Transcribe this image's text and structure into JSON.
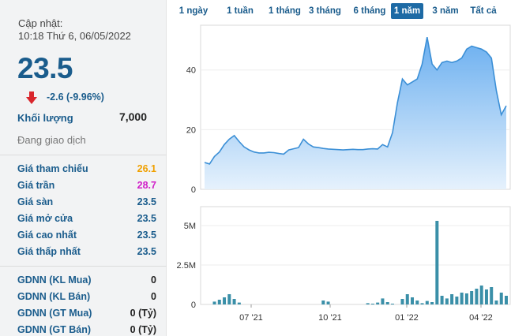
{
  "quote": {
    "updated_label": "Cập nhật:",
    "updated_time": "10:18 Thứ 6, 06/05/2022",
    "price": "23.5",
    "change": "-2.6 (-9.96%)",
    "change_direction_icon": "arrow-down-icon",
    "volume_label": "Khối lượng",
    "volume_value": "7,000",
    "status": "Đang giao dịch"
  },
  "price_rows": [
    {
      "label": "Giá tham chiếu",
      "value": "26.1",
      "color": "#f0a000"
    },
    {
      "label": "Giá trần",
      "value": "28.7",
      "color": "#d020c8"
    },
    {
      "label": "Giá sàn",
      "value": "23.5",
      "color": "#1a5c8c"
    },
    {
      "label": "Giá mở cửa",
      "value": "23.5",
      "color": "#1a5c8c"
    },
    {
      "label": "Giá cao nhất",
      "value": "23.5",
      "color": "#1a5c8c"
    },
    {
      "label": "Giá thấp nhất",
      "value": "23.5",
      "color": "#1a5c8c"
    }
  ],
  "foreign_rows": [
    {
      "label": "GDNN (KL Mua)",
      "value": "0"
    },
    {
      "label": "GDNN (KL Bán)",
      "value": "0"
    },
    {
      "label": "GDNN (GT Mua)",
      "value": "0 (Tỷ)"
    },
    {
      "label": "GDNN (GT Bán)",
      "value": "0 (Tỷ)"
    }
  ],
  "range_tabs": [
    "1 ngày",
    "1 tuần",
    "1 tháng",
    "3 tháng",
    "6 tháng",
    "1 năm",
    "3 năm",
    "Tất cả"
  ],
  "active_tab": "1 năm",
  "colors": {
    "accent": "#1d6aa5",
    "down": "#d9262c",
    "area_fill": "#6fb0ea",
    "line": "#3b8fd6",
    "bar": "#3a8fa8"
  },
  "chart_data": [
    {
      "type": "area",
      "y_ticks": [
        "0",
        "20",
        "40"
      ],
      "ylim": [
        0,
        55
      ],
      "values": [
        9,
        8.5,
        11,
        12.5,
        15,
        16.8,
        18,
        16,
        14.2,
        13.2,
        12.5,
        12.2,
        12.2,
        12.4,
        12.3,
        12,
        11.8,
        13.2,
        13.6,
        14,
        16.8,
        15.2,
        14.2,
        14,
        13.7,
        13.5,
        13.4,
        13.3,
        13.2,
        13.3,
        13.4,
        13.3,
        13.3,
        13.5,
        13.6,
        13.5,
        15,
        14.2,
        19,
        29,
        37,
        35,
        36,
        37,
        42,
        51,
        42,
        40,
        42.5,
        43,
        42.5,
        43,
        44,
        47,
        48,
        47.5,
        47,
        46,
        44,
        33,
        25,
        28
      ]
    },
    {
      "type": "bar",
      "y_ticks": [
        "0",
        "2.5M",
        "5M"
      ],
      "ylim": [
        0,
        6.2
      ],
      "x_ticks": [
        "07 '21",
        "10 '21",
        "01 '22",
        "04 '22"
      ],
      "values": [
        0,
        0,
        0.18,
        0.3,
        0.45,
        0.65,
        0.35,
        0.12,
        0,
        0,
        0,
        0,
        0,
        0,
        0,
        0,
        0,
        0,
        0,
        0,
        0,
        0,
        0,
        0,
        0.25,
        0.18,
        0,
        0,
        0,
        0,
        0,
        0,
        0,
        0.08,
        0.05,
        0.12,
        0.38,
        0.15,
        0.05,
        0,
        0.35,
        0.65,
        0.45,
        0.25,
        0.08,
        0.22,
        0.15,
        5.3,
        0.55,
        0.38,
        0.65,
        0.5,
        0.75,
        0.7,
        0.85,
        1,
        1.2,
        0.95,
        1.1,
        0.25,
        0.75,
        0.55
      ]
    }
  ]
}
